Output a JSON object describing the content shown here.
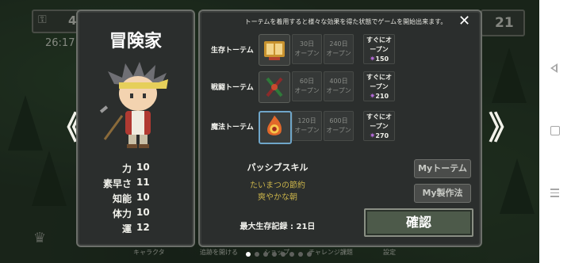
{
  "top_bar": {
    "left_value": "4",
    "time": "26:17",
    "right_value": "21"
  },
  "navigation": {
    "prev_symbol": "《",
    "next_symbol": "》"
  },
  "character": {
    "name": "冒険家",
    "stats": [
      {
        "label": "力",
        "value": "10"
      },
      {
        "label": "素早さ",
        "value": "11"
      },
      {
        "label": "知能",
        "value": "10"
      },
      {
        "label": "体力",
        "value": "10"
      },
      {
        "label": "運",
        "value": "12"
      }
    ]
  },
  "dialog": {
    "info": "トーテムを着用すると様々な効果を得た状態でゲームを開始出来ます。",
    "close_symbol": "✕",
    "totems": [
      {
        "label": "生存トーテム",
        "icon": "book-totem-icon",
        "opt1": [
          "30日",
          "オープン"
        ],
        "opt2": [
          "240日",
          "オープン"
        ],
        "now": [
          "すぐにオ",
          "ープン"
        ],
        "cost": "150"
      },
      {
        "label": "戦闘トーテム",
        "icon": "axe-totem-icon",
        "opt1": [
          "60日",
          "オープン"
        ],
        "opt2": [
          "400日",
          "オープン"
        ],
        "now": [
          "すぐにオ",
          "ープン"
        ],
        "cost": "210"
      },
      {
        "label": "魔法トーテム",
        "icon": "flame-totem-icon",
        "opt1": [
          "120日",
          "オープン"
        ],
        "opt2": [
          "600日",
          "オープン"
        ],
        "now": [
          "すぐにオ",
          "ープン"
        ],
        "cost": "270"
      }
    ],
    "passive_title": "パッシブスキル",
    "passive_skills": [
      "たいまつの節約",
      "爽やかな朝"
    ],
    "record": "最大生存記録 : 21日",
    "my_totem_label": "Myトーテム",
    "my_crafting_label": "My製作法",
    "confirm_label": "確認"
  },
  "bottom": {
    "items": [
      "キャラクタ",
      "追跡を開ける",
      "ショップ",
      "チャレンジ課題",
      "設定"
    ]
  },
  "colors": {
    "panel": "#2b2e2d",
    "skill_text": "#c8b24a",
    "gem": "#b46ad8",
    "confirm": "#4d5a4a"
  }
}
